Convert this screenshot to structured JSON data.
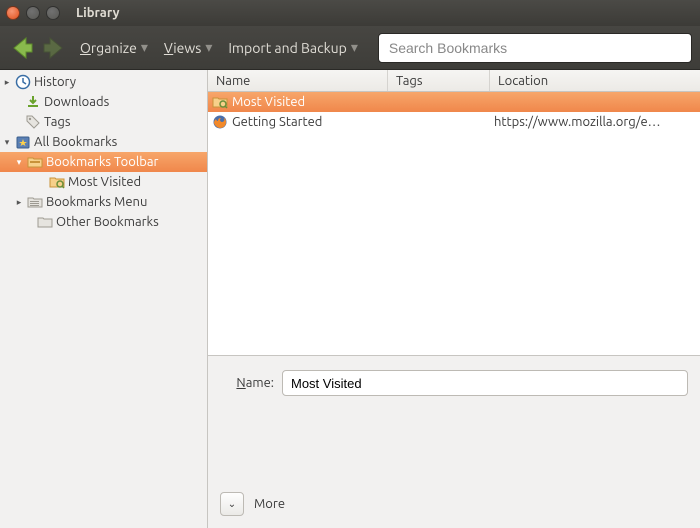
{
  "window": {
    "title": "Library"
  },
  "toolbar": {
    "menus": {
      "organize": "Organize",
      "views": "Views",
      "import": "Import and Backup"
    },
    "search_placeholder": "Search Bookmarks"
  },
  "sidebar": {
    "items": [
      {
        "id": "history",
        "label": "History",
        "expander": "▸",
        "indent": 0,
        "icon": "clock"
      },
      {
        "id": "downloads",
        "label": "Downloads",
        "expander": "",
        "indent": 10,
        "icon": "download"
      },
      {
        "id": "tags",
        "label": "Tags",
        "expander": "",
        "indent": 10,
        "icon": "tag"
      },
      {
        "id": "all-bookmarks",
        "label": "All Bookmarks",
        "expander": "▾",
        "indent": 0,
        "icon": "bookmark-all"
      },
      {
        "id": "bookmarks-toolbar",
        "label": "Bookmarks Toolbar",
        "expander": "▾",
        "indent": 12,
        "icon": "folder-toolbar",
        "selected": true
      },
      {
        "id": "most-visited-side",
        "label": "Most Visited",
        "expander": "",
        "indent": 34,
        "icon": "smart-folder"
      },
      {
        "id": "bookmarks-menu",
        "label": "Bookmarks Menu",
        "expander": "▸",
        "indent": 12,
        "icon": "folder-menu"
      },
      {
        "id": "other-bookmarks",
        "label": "Other Bookmarks",
        "expander": "",
        "indent": 22,
        "icon": "folder-other"
      }
    ]
  },
  "columns": {
    "name": "Name",
    "tags": "Tags",
    "location": "Location"
  },
  "rows": [
    {
      "name": "Most Visited",
      "tags": "",
      "location": "",
      "icon": "smart-folder",
      "selected": true
    },
    {
      "name": "Getting Started",
      "tags": "",
      "location": "https://www.mozilla.org/e…",
      "icon": "firefox",
      "selected": false
    }
  ],
  "details": {
    "name_label": "Name:",
    "name_value": "Most Visited",
    "more_label": "More"
  }
}
